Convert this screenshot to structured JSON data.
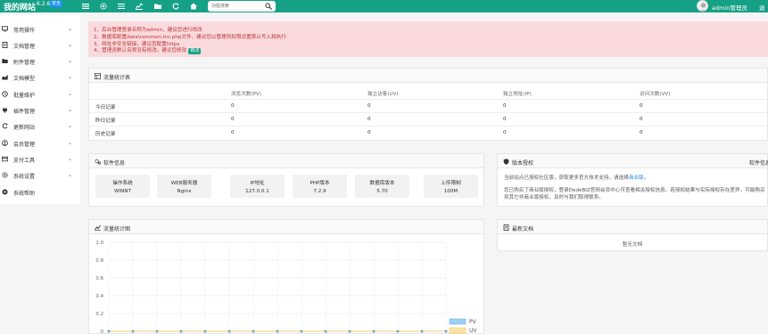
{
  "header": {
    "brand": "我的网站",
    "version": "6.2.6",
    "badge": "安全",
    "search_placeholder": "功能搜索",
    "username": "admin管理员",
    "logout": "退",
    "colors": {
      "bar": "#16a085",
      "badge": "#1e90ff"
    },
    "icons": [
      "menu-grid-icon",
      "gear-icon",
      "list-icon",
      "chart-icon",
      "folder-icon",
      "refresh-icon",
      "home-icon"
    ]
  },
  "sidebar": {
    "items": [
      {
        "label": "常用操作",
        "icon": "monitor-icon"
      },
      {
        "label": "文档管理",
        "icon": "doc-icon"
      },
      {
        "label": "附件管理",
        "icon": "folder-icon"
      },
      {
        "label": "文档模型",
        "icon": "chart-icon"
      },
      {
        "label": "批量维护",
        "icon": "clock-icon"
      },
      {
        "label": "插件管理",
        "icon": "plug-icon"
      },
      {
        "label": "更新网站",
        "icon": "refresh-icon"
      },
      {
        "label": "会员管理",
        "icon": "user-icon"
      },
      {
        "label": "支付工具",
        "icon": "card-icon"
      },
      {
        "label": "系统设置",
        "icon": "gear-icon"
      },
      {
        "label": "系统帮助",
        "icon": "help-icon"
      }
    ]
  },
  "alert": {
    "lines": [
      "1、后台管理登录名称为admin，建议您进行修改",
      "2、数据库配置data\\common.inc.php文件，建议您以管理员权限设置禁止写入和执行",
      "3、网址非安全链接，建议您配置https",
      "4、管理员默认名称没有修改，建议您修改"
    ],
    "action": "修改"
  },
  "traffic": {
    "title": "流量统计表",
    "columns": [
      "",
      "浏览次数(PV)",
      "独立访客(UV)",
      "独立地址(IP)",
      "访问次数(VV)"
    ],
    "rows": [
      [
        "今日记录",
        "0",
        "0",
        "0",
        "0"
      ],
      [
        "昨日记录",
        "0",
        "0",
        "0",
        "0"
      ],
      [
        "历史记录",
        "0",
        "0",
        "0",
        "0"
      ]
    ]
  },
  "software": {
    "title": "软件信息",
    "cards": [
      {
        "label": "操作系统",
        "value": "WINNT"
      },
      {
        "label": "WEB服务器",
        "value": "Nginx"
      },
      {
        "label": "IP地址",
        "value": "127.0.0.1"
      },
      {
        "label": "PHP版本",
        "value": "7.2.9"
      },
      {
        "label": "数据库版本",
        "value": "5.70"
      },
      {
        "label": "上传限制",
        "value": "100M"
      }
    ]
  },
  "license": {
    "title": "版本授权",
    "right_label": "软件信息",
    "text1": "当前站点已授权社区版，获取更多官方技术支持，请选择",
    "link1": "商业版",
    "text1_end": "。",
    "text2": "您已购买了商业版授权，登录DedeBIZ官网会员中心可查看相关授权信息。若授权结果与实际授权存在差异，可能购买到其它非商业版授权，及时与我们取得联系。"
  },
  "chart_panel": {
    "title": "流量统计图"
  },
  "news": {
    "title": "最新文档",
    "empty": "暂无文档"
  },
  "chart_data": {
    "type": "line",
    "ylim": [
      0,
      1.0
    ],
    "yticks": [
      "1.0",
      "0.8",
      "0.6",
      "0.4",
      "0.2",
      "0"
    ],
    "points_count": 15,
    "series": [
      {
        "name": "PV",
        "values": [
          0,
          0,
          0,
          0,
          0,
          0,
          0,
          0,
          0,
          0,
          0,
          0,
          0,
          0,
          0
        ],
        "color": "#9ad0f5"
      },
      {
        "name": "UV",
        "values": [
          0,
          0,
          0,
          0,
          0,
          0,
          0,
          0,
          0,
          0,
          0,
          0,
          0,
          0,
          0
        ],
        "color": "#ffe3a3"
      }
    ],
    "grid": true,
    "legend": "bottom-right"
  }
}
